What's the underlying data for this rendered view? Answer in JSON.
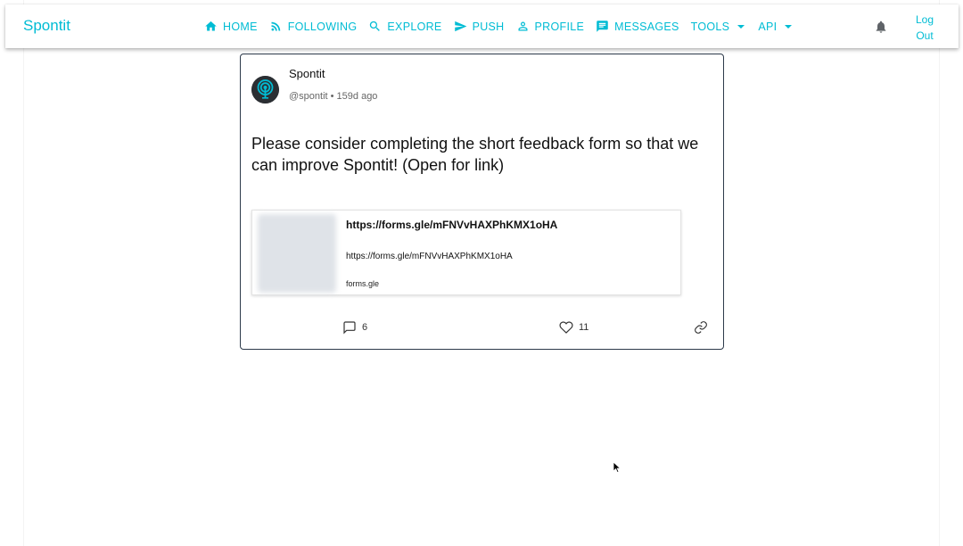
{
  "app": {
    "brand": "Spontit"
  },
  "nav": {
    "items": [
      {
        "label": "HOME",
        "icon": "home-icon"
      },
      {
        "label": "FOLLOWING",
        "icon": "rss-icon"
      },
      {
        "label": "EXPLORE",
        "icon": "search-icon"
      },
      {
        "label": "PUSH",
        "icon": "send-icon"
      },
      {
        "label": "PROFILE",
        "icon": "person-icon"
      },
      {
        "label": "MESSAGES",
        "icon": "chat-icon"
      },
      {
        "label": "TOOLS",
        "icon": "caret-down-icon"
      },
      {
        "label": "API",
        "icon": "caret-down-icon"
      }
    ],
    "logout_line1": "Log",
    "logout_line2": "Out"
  },
  "post": {
    "author_name": "Spontit",
    "author_handle": "@spontit",
    "separator": " • ",
    "age": "159d ago",
    "text": "Please consider completing the short feedback form so that we can improve Spontit! (Open for link)",
    "link": {
      "title": "https://forms.gle/mFNVvHAXPhKMX1oHA",
      "description": "https://forms.gle/mFNVvHAXPhKMX1oHA",
      "domain": "forms.gle"
    },
    "comments": "6",
    "likes": "11"
  },
  "colors": {
    "accent": "#00bcd4",
    "card_border": "#2d3a4a"
  }
}
